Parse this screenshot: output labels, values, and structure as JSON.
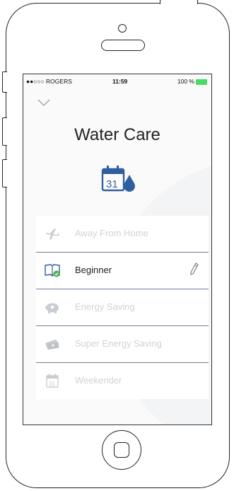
{
  "status_bar": {
    "carrier": "●●○○○ ROGERS",
    "time": "11:59",
    "battery": "100 %"
  },
  "page": {
    "title": "Water Care"
  },
  "modes": [
    {
      "label": "Away From Home",
      "icon": "airplane-icon",
      "active": false
    },
    {
      "label": "Beginner",
      "icon": "book-icon",
      "active": true
    },
    {
      "label": "Energy Saving",
      "icon": "piggy-bank-icon",
      "active": false
    },
    {
      "label": "Super Energy Saving",
      "icon": "money-icon",
      "active": false
    },
    {
      "label": "Weekender",
      "icon": "calendar-icon",
      "active": false
    }
  ],
  "colors": {
    "accent_blue": "#2f5f9e",
    "check_green": "#4cb04a",
    "battery_green": "#4cd964",
    "divider": "#6c7f95"
  }
}
